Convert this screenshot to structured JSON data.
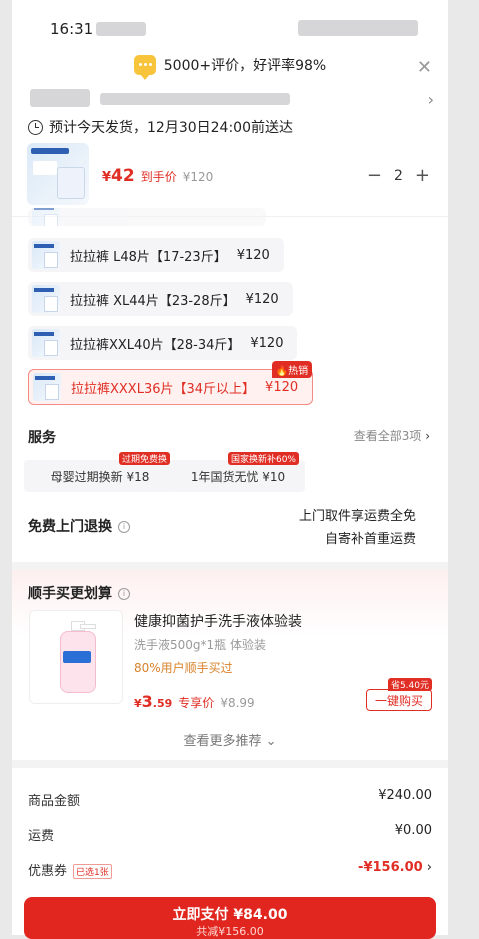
{
  "status": {
    "time": "16:31"
  },
  "rating": {
    "text": "5000+评价，好评率98%"
  },
  "shipping": {
    "text": "预计今天发货，12月30日24:00前送达"
  },
  "product": {
    "currency": "¥",
    "price": "42",
    "price_label": "到手价",
    "original_price": "¥120",
    "quantity": "2",
    "minus": "−",
    "plus": "+"
  },
  "skus": [
    {
      "label": "拉拉裤 L48片【17-23斤】",
      "price": "¥120"
    },
    {
      "label": "拉拉裤 XL44片【23-28斤】",
      "price": "¥120"
    },
    {
      "label": "拉拉裤XXL40片【28-34斤】",
      "price": "¥120"
    },
    {
      "label": "拉拉裤XXXL36片【34斤以上】",
      "price": "¥120",
      "hot": "热销",
      "selected": true
    }
  ],
  "services": {
    "title": "服务",
    "see_all": "查看全部3项",
    "items": [
      {
        "label": "母婴过期换新 ¥18",
        "badge": "过期免费换"
      },
      {
        "label": "1年国货无忧 ¥10",
        "badge": "国家换新补60%"
      }
    ]
  },
  "returns": {
    "title": "免费上门退换",
    "line1": "上门取件享运费全免",
    "line2": "自寄补首重运费"
  },
  "recommend": {
    "title": "顺手买更划算",
    "product_title": "健康抑菌护手洗手液体验装",
    "spec": "洗手液500g*1瓶 体验装",
    "stat": "80%用户顺手买过",
    "price_symbol": "¥",
    "price_int": "3",
    "price_dec": ".59",
    "price_label": "专享价",
    "orig_price": "¥8.99",
    "save_badge": "省5.40元",
    "buy_label": "一键购买",
    "more": "查看更多推荐"
  },
  "summary": {
    "goods_label": "商品金额",
    "goods_value": "¥240.00",
    "shipping_label": "运费",
    "shipping_value": "¥0.00",
    "coupon_label": "优惠券",
    "coupon_tag": "已选1张",
    "coupon_value": "-¥156.00"
  },
  "pay": {
    "label": "立即支付 ¥84.00",
    "sub": "共减¥156.00"
  },
  "colors": {
    "accent": "#e02e24",
    "badge_yellow": "#f7c43b"
  }
}
